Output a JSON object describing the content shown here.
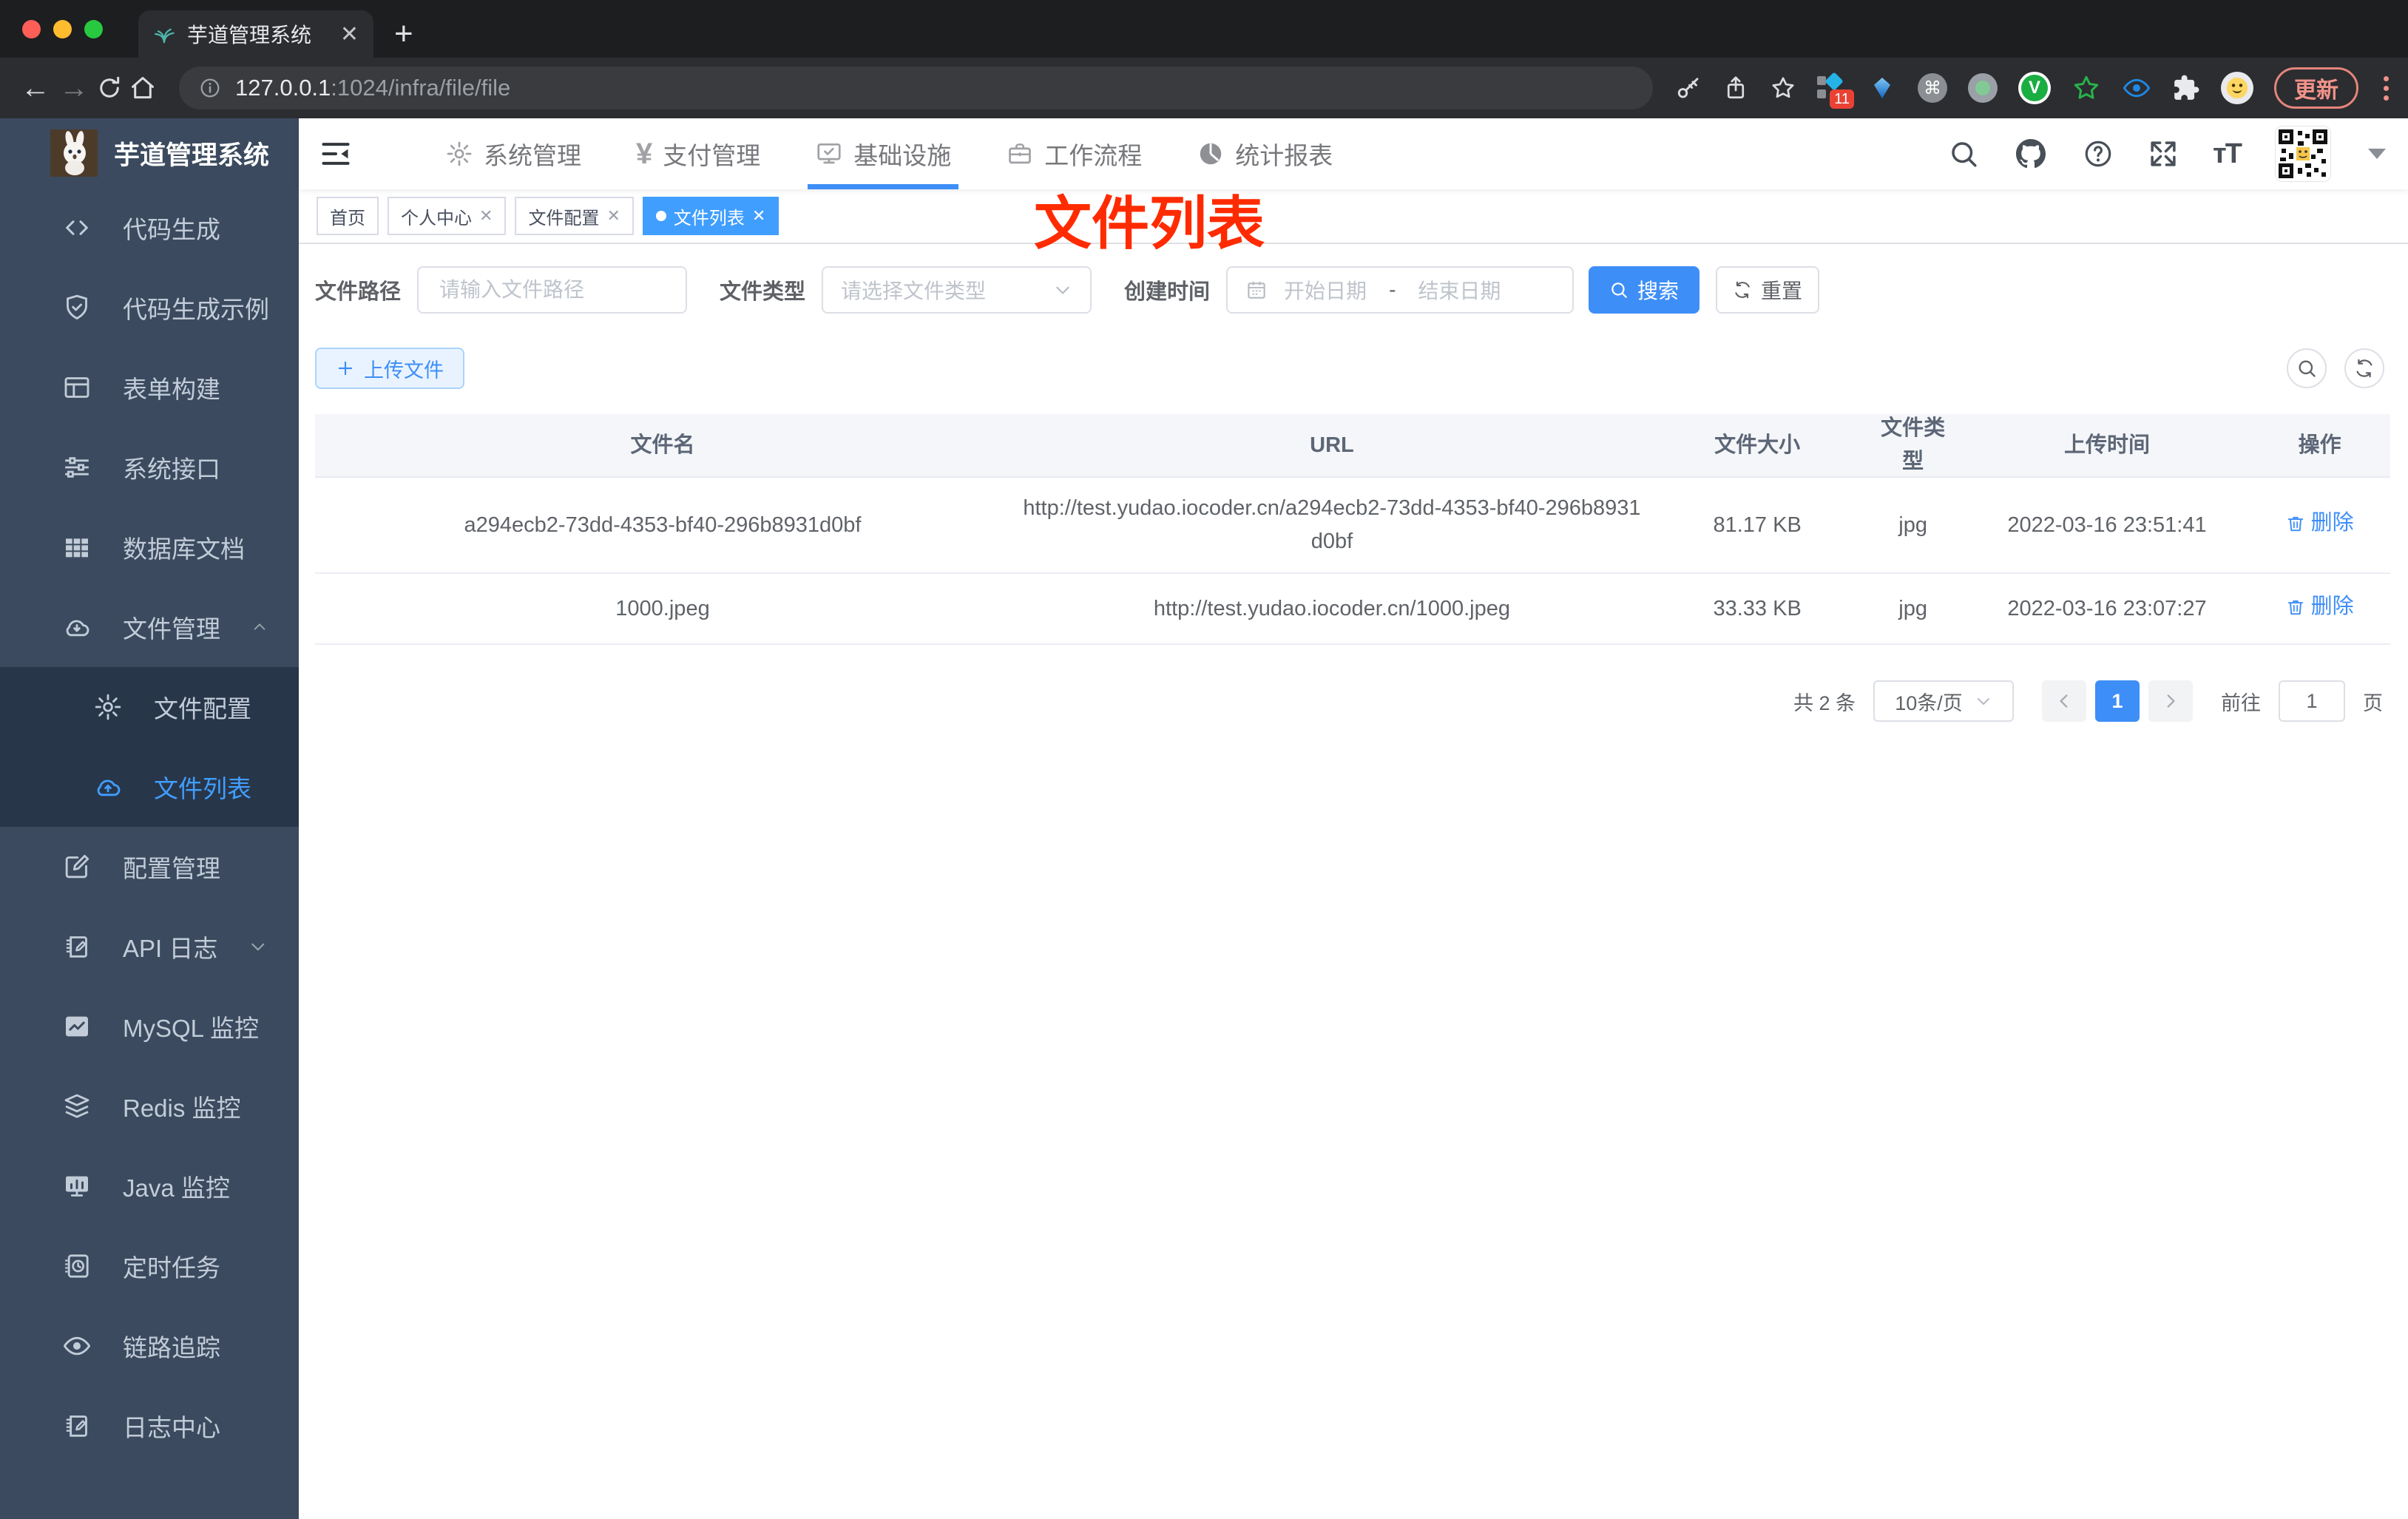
{
  "browser": {
    "tab_title": "芋道管理系统",
    "close_tab": "✕",
    "new_tab": "+",
    "url_host": "127.0.0.1",
    "url_rest": ":1024/infra/file/file",
    "extension_badge": "11",
    "update_label": "更新"
  },
  "sidebar": {
    "title": "芋道管理系统",
    "items": [
      {
        "label": "代码生成"
      },
      {
        "label": "代码生成示例"
      },
      {
        "label": "表单构建"
      },
      {
        "label": "系统接口"
      },
      {
        "label": "数据库文档"
      },
      {
        "label": "文件管理"
      },
      {
        "label": "文件配置"
      },
      {
        "label": "文件列表"
      },
      {
        "label": "配置管理"
      },
      {
        "label": "API 日志"
      },
      {
        "label": "MySQL 监控"
      },
      {
        "label": "Redis 监控"
      },
      {
        "label": "Java 监控"
      },
      {
        "label": "定时任务"
      },
      {
        "label": "链路追踪"
      },
      {
        "label": "日志中心"
      }
    ]
  },
  "topnav": {
    "items": [
      {
        "label": "系统管理"
      },
      {
        "label": "支付管理"
      },
      {
        "label": "基础设施"
      },
      {
        "label": "工作流程"
      },
      {
        "label": "统计报表"
      }
    ]
  },
  "tags": [
    {
      "label": "首页"
    },
    {
      "label": "个人中心"
    },
    {
      "label": "文件配置"
    },
    {
      "label": "文件列表"
    }
  ],
  "annotation": "文件列表",
  "filters": {
    "path_label": "文件路径",
    "path_placeholder": "请输入文件路径",
    "type_label": "文件类型",
    "type_placeholder": "请选择文件类型",
    "date_label": "创建时间",
    "date_start_placeholder": "开始日期",
    "date_separator": "-",
    "date_end_placeholder": "结束日期",
    "search_label": "搜索",
    "reset_label": "重置"
  },
  "toolbar": {
    "upload_label": "上传文件"
  },
  "table": {
    "columns": [
      "文件名",
      "URL",
      "文件大小",
      "文件类型",
      "上传时间",
      "操作"
    ],
    "rows": [
      {
        "name": "a294ecb2-73dd-4353-bf40-296b8931d0bf",
        "url": "http://test.yudao.iocoder.cn/a294ecb2-73dd-4353-bf40-296b8931d0bf",
        "size": "81.17 KB",
        "type": "jpg",
        "time": "2022-03-16 23:51:41",
        "action": "删除"
      },
      {
        "name": "1000.jpeg",
        "url": "http://test.yudao.iocoder.cn/1000.jpeg",
        "size": "33.33 KB",
        "type": "jpg",
        "time": "2022-03-16 23:07:27",
        "action": "删除"
      }
    ]
  },
  "pagination": {
    "total_text": "共 2 条",
    "page_size": "10条/页",
    "current_page": "1",
    "goto_label": "前往",
    "goto_value": "1",
    "page_unit": "页"
  }
}
